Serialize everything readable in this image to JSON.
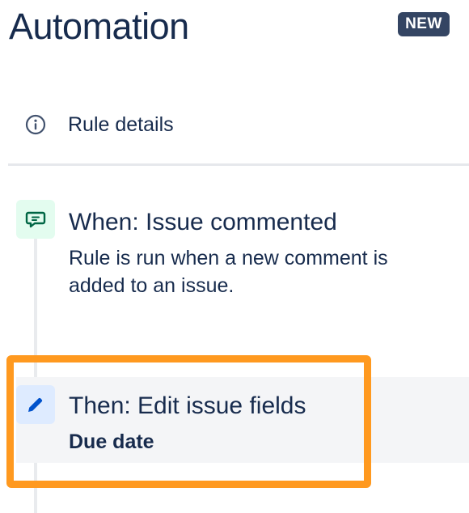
{
  "header": {
    "title": "Automation",
    "badge": "NEW"
  },
  "nav": {
    "rule_details_label": "Rule details",
    "icon": "info-icon"
  },
  "trigger": {
    "icon": "comment-icon",
    "title": "When: Issue commented",
    "description": "Rule is run when a new comment is added to an issue."
  },
  "action": {
    "icon": "pencil-icon",
    "title": "Then: Edit issue fields",
    "subtitle": "Due date"
  },
  "colors": {
    "text": "#172b4d",
    "badge_bg": "#344563",
    "trigger_icon_bg": "#e3fcef",
    "trigger_icon_fg": "#006644",
    "action_icon_bg": "#deebff",
    "action_icon_fg": "#0052cc",
    "highlight": "#ff991f"
  }
}
